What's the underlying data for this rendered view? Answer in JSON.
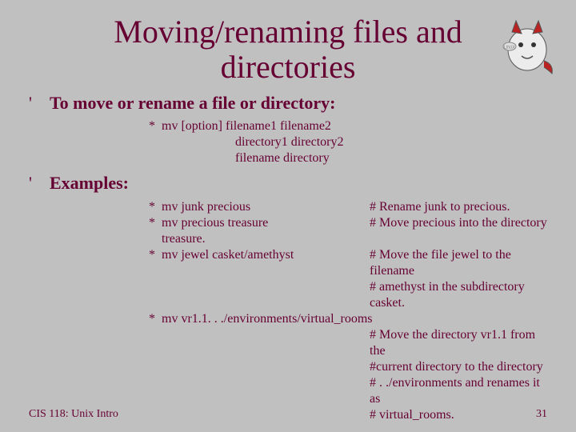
{
  "title": "Moving/renaming files and directories",
  "bullets": {
    "b1": "To move or rename a file or directory:",
    "b2": "Examples:"
  },
  "syntax": {
    "l1": "mv [option] filename1 filename2",
    "l2": "directory1 directory2",
    "l3": "filename directory"
  },
  "ex": {
    "e1_cmd": "mv junk   precious",
    "e1_cmt": "# Rename junk to precious.",
    "e2_cmd": "mv precious treasure",
    "e2_cmt": "# Move precious into the directory",
    "e2b_cmd": "treasure.",
    "e3_cmd": "mv jewel casket/amethyst",
    "e3_cmt": "# Move the file jewel to the filename",
    "e3b_cmt": "# amethyst in the subdirectory casket.",
    "e4_cmd": "mv vr1.1. . ./environments/virtual_rooms",
    "e4_c1": "# Move the directory vr1.1 from the",
    "e4_c2": "#current  directory to the directory",
    "e4_c3": "# . ./environments and renames it as",
    "e4_c4": "# virtual_rooms."
  },
  "footer": {
    "left": "CIS 118: Unix Intro",
    "right": "31"
  },
  "bullet_char": "'",
  "star_char": "*"
}
